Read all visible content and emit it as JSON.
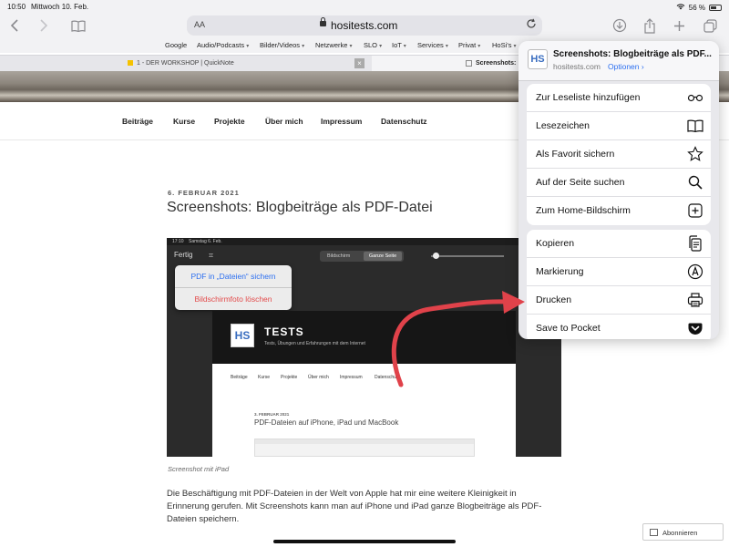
{
  "status": {
    "time": "10:50",
    "date": "Mittwoch 10. Feb.",
    "battery": "56 %",
    "battery_level": 0.56
  },
  "toolbar": {
    "aa": "AA",
    "url": "hositests.com"
  },
  "favorites": [
    {
      "label": "Google",
      "dropdown": false
    },
    {
      "label": "Audio/Podcasts",
      "dropdown": true
    },
    {
      "label": "Bilder/Videos",
      "dropdown": true
    },
    {
      "label": "Netzwerke",
      "dropdown": true
    },
    {
      "label": "SLO",
      "dropdown": true
    },
    {
      "label": "IoT",
      "dropdown": true
    },
    {
      "label": "Services",
      "dropdown": true
    },
    {
      "label": "Privat",
      "dropdown": true
    },
    {
      "label": "HoSi's",
      "dropdown": true
    }
  ],
  "tabs": [
    {
      "title": "1 - DER WORKSHOP | QuickNote"
    },
    {
      "title": "Screenshots:"
    }
  ],
  "site_nav": [
    "Beiträge",
    "Kurse",
    "Projekte",
    "Über mich",
    "Impressum",
    "Datenschutz"
  ],
  "post": {
    "date": "6. FEBRUAR 2021",
    "title": "Screenshots: Blogbeiträge als PDF-Datei",
    "caption": "Screenshot mit iPad",
    "body": "Die Beschäftigung mit PDF-Dateien in der Welt von Apple hat mir eine weitere Kleinigkeit in Erinnerung gerufen. Mit Screenshots kann man auf iPhone und iPad ganze Blogbeiträge als PDF-Dateien speichern."
  },
  "embedded": {
    "time": "17:10",
    "date": "Samstag 6. Feb.",
    "fertig": "Fertig",
    "seg_a": "Bildschirm",
    "seg_b": "Ganze Seite",
    "popup_save": "PDF in „Dateien“ sichern",
    "popup_delete": "Bildschirmfoto löschen",
    "logo": "HS",
    "site_title": "TESTS",
    "tagline": "Tests, Übungen und Erfahrungen mit dem Internet",
    "nav": [
      "Beiträge",
      "Kurse",
      "Projekte",
      "Über mich",
      "Impressum",
      "Datenschutz"
    ],
    "post_date": "3. FEBRUAR 2021",
    "post_title": "PDF-Dateien auf iPhone, iPad und MacBook"
  },
  "sheet": {
    "logo": "HS",
    "title": "Screenshots: Blogbeiträge als PDF...",
    "domain": "hositests.com",
    "options": "Optionen ›",
    "group1": [
      {
        "label": "Zur Leseliste hinzufügen",
        "icon": "glasses-icon"
      },
      {
        "label": "Lesezeichen",
        "icon": "book-icon"
      },
      {
        "label": "Als Favorit sichern",
        "icon": "star-icon"
      },
      {
        "label": "Auf der Seite suchen",
        "icon": "search-icon"
      },
      {
        "label": "Zum Home-Bildschirm",
        "icon": "add-square-icon"
      }
    ],
    "group2": [
      {
        "label": "Kopieren",
        "icon": "copy-icon"
      },
      {
        "label": "Markierung",
        "icon": "markup-icon"
      },
      {
        "label": "Drucken",
        "icon": "printer-icon"
      },
      {
        "label": "Save to Pocket",
        "icon": "pocket-icon"
      }
    ]
  },
  "abonnieren": "Abonnieren",
  "colors": {
    "accent": "#2c6ff0",
    "annotation_arrow": "#e0424a",
    "danger": "#e34b4b"
  }
}
